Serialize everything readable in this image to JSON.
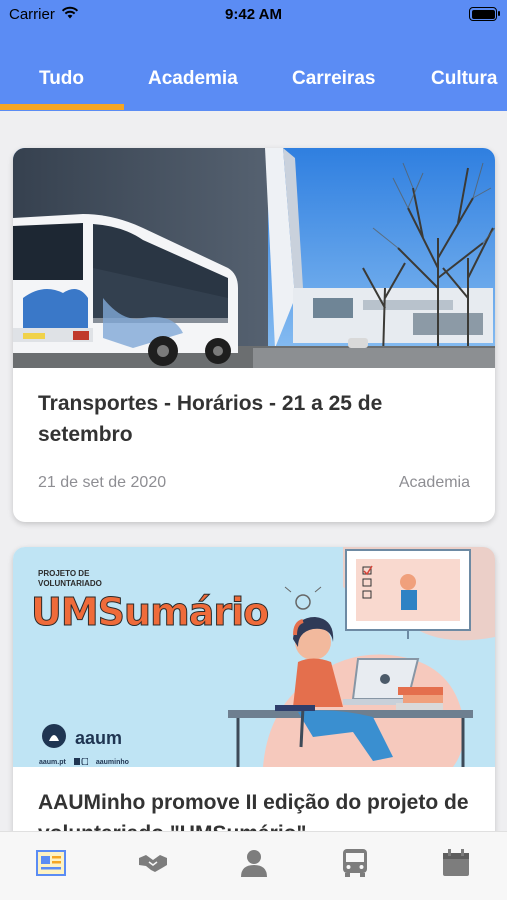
{
  "status_bar": {
    "carrier": "Carrier",
    "time": "9:42 AM",
    "wifi_icon": "wifi-icon",
    "battery_icon": "battery-icon"
  },
  "colors": {
    "header": "#5b8cf4",
    "tab_indicator": "#f5a623",
    "background": "#efeff1",
    "card_title": "#333333",
    "card_meta": "#8e8e93"
  },
  "tabs": [
    {
      "label": "Tudo",
      "selected": true
    },
    {
      "label": "Academia",
      "selected": false
    },
    {
      "label": "Carreiras",
      "selected": false
    },
    {
      "label": "Cultura",
      "selected": false
    }
  ],
  "articles": [
    {
      "title": "Transportes - Horários - 21 a 25 de setembro",
      "date": "21 de set de 2020",
      "category": "Academia",
      "image": "bus-photo"
    },
    {
      "title": "AAUMinho promove II edição do projeto de voluntariado \"UMSumário\"",
      "image": "umsumario-illustration",
      "image_text": {
        "kicker_line1": "PROJETO DE",
        "kicker_line2": "VOLUNTARIADO",
        "headline": "UMSumário",
        "brand": "aaum",
        "website": "aaum.pt",
        "social": "aauminho"
      }
    }
  ],
  "bottom_nav": [
    {
      "icon": "news-icon",
      "selected": true
    },
    {
      "icon": "handshake-icon",
      "selected": false
    },
    {
      "icon": "profile-icon",
      "selected": false
    },
    {
      "icon": "bus-icon",
      "selected": false
    },
    {
      "icon": "calendar-icon",
      "selected": false
    }
  ]
}
